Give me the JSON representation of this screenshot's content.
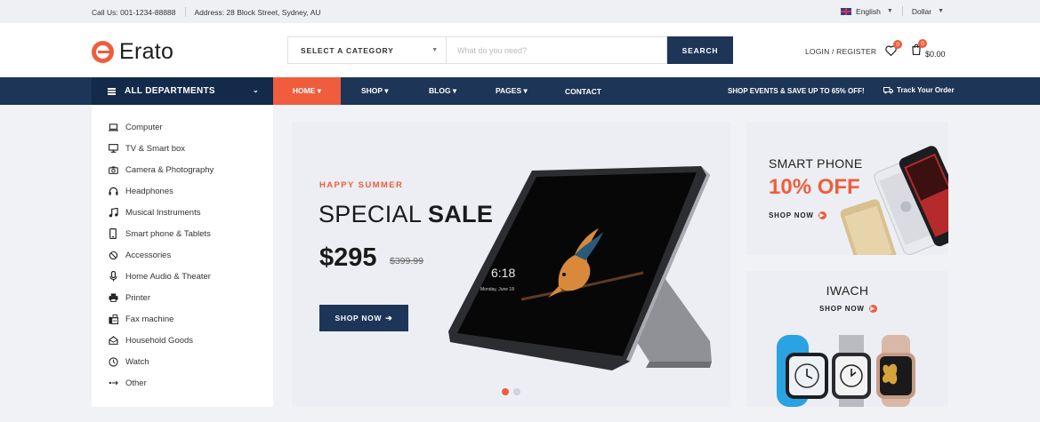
{
  "topbar": {
    "phone": "Call Us: 001-1234-88888",
    "address": "Address: 28 Block Street, Sydney, AU",
    "language": "English",
    "currency": "Dollar"
  },
  "header": {
    "logo_text": "Erato",
    "category_select": "SELECT A CATEGORY",
    "search_placeholder": "What do you need?",
    "search_button": "SEARCH",
    "login": "LOGIN / REGISTER",
    "wishlist_count": "0",
    "cart_count": "0",
    "cart_total": "$0.00"
  },
  "nav": {
    "departments": "ALL DEPARTMENTS",
    "items": [
      {
        "label": "HOME ▾"
      },
      {
        "label": "SHOP ▾"
      },
      {
        "label": "BLOG ▾"
      },
      {
        "label": "PAGES ▾"
      },
      {
        "label": "CONTACT"
      }
    ],
    "promo": "SHOP EVENTS & SAVE UP TO 65% OFF!",
    "track": "Track Your Order"
  },
  "sidebar": {
    "items": [
      {
        "label": "Computer",
        "icon": "computer-icon"
      },
      {
        "label": "TV & Smart box",
        "icon": "tv-icon"
      },
      {
        "label": "Camera & Photography",
        "icon": "camera-icon"
      },
      {
        "label": "Headphones",
        "icon": "headphones-icon"
      },
      {
        "label": "Musical Instruments",
        "icon": "music-icon"
      },
      {
        "label": "Smart phone & Tablets",
        "icon": "phone-icon"
      },
      {
        "label": "Accessories",
        "icon": "accessories-icon"
      },
      {
        "label": "Home Audio & Theater",
        "icon": "microphone-icon"
      },
      {
        "label": "Printer",
        "icon": "printer-icon"
      },
      {
        "label": "Fax machine",
        "icon": "fax-icon"
      },
      {
        "label": "Household Goods",
        "icon": "household-icon"
      },
      {
        "label": "Watch",
        "icon": "watch-icon"
      },
      {
        "label": "Other",
        "icon": "other-icon"
      }
    ]
  },
  "hero": {
    "eyebrow": "HAPPY SUMMER",
    "headline_light": "SPECIAL ",
    "headline_bold": "SALE",
    "price": "$295",
    "old_price": "$399.99",
    "button": "SHOP NOW",
    "tablet_time": "6:18",
    "tablet_date": "Monday, June 18"
  },
  "banners": {
    "phone": {
      "title": "SMART PHONE",
      "discount": "10% OFF",
      "link": "SHOP NOW"
    },
    "watch": {
      "title": "IWACH",
      "link": "SHOP NOW"
    }
  },
  "colors": {
    "accent": "#ef5d3d",
    "navy": "#1d3557",
    "navy_dark": "#142a4a"
  }
}
